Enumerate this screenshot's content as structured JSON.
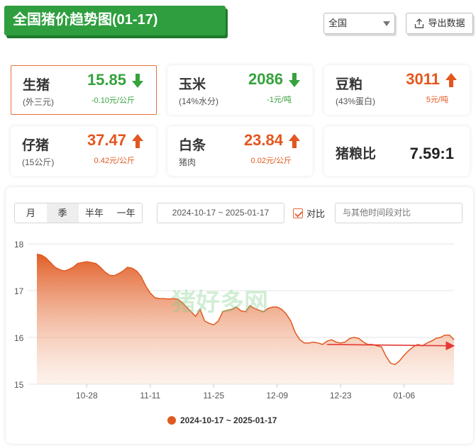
{
  "header": {
    "title": "全国猪价趋势图(01-17)",
    "region": "全国",
    "export_label": "导出数据"
  },
  "cards": {
    "hog": {
      "name": "生猪",
      "sub": "(外三元)",
      "price": "15.85",
      "change": "-0.10元/公斤",
      "direction": "down"
    },
    "corn": {
      "name": "玉米",
      "sub": "(14%水分)",
      "price": "2086",
      "change": "-1元/吨",
      "direction": "down"
    },
    "soymeal": {
      "name": "豆粕",
      "sub": "(43%蛋白)",
      "price": "3011",
      "change": "5元/吨",
      "direction": "up"
    },
    "piglet": {
      "name": "仔猪",
      "sub": "(15公斤)",
      "price": "37.47",
      "change": "0.42元/公斤",
      "direction": "up"
    },
    "carcass": {
      "name": "白条",
      "sub": "猪肉",
      "price": "23.84",
      "change": "0.02元/公斤",
      "direction": "up"
    },
    "ratio": {
      "name": "猪粮比",
      "value": "7.59:1"
    }
  },
  "controls": {
    "periods": [
      "月",
      "季",
      "半年",
      "一年"
    ],
    "selected_period": "季",
    "date_range": "2024-10-17 ~ 2025-01-17",
    "compare_label": "对比",
    "compare_placeholder": "与其他时间段对比"
  },
  "colors": {
    "up": "#e3561d",
    "down": "#36a23c",
    "line": "#e05a20",
    "accent": "#2e9e3e"
  },
  "chart_data": {
    "type": "area",
    "title": "",
    "xlabel": "",
    "ylabel": "",
    "ylim": [
      15,
      18
    ],
    "yticks": [
      15,
      16,
      17,
      18
    ],
    "x_ticks": [
      "10-28",
      "11-11",
      "11-25",
      "12-09",
      "12-23",
      "01-06"
    ],
    "x": [
      "10-17",
      "10-18",
      "10-19",
      "10-20",
      "10-21",
      "10-22",
      "10-23",
      "10-24",
      "10-25",
      "10-26",
      "10-27",
      "10-28",
      "10-29",
      "10-30",
      "10-31",
      "11-01",
      "11-02",
      "11-03",
      "11-04",
      "11-05",
      "11-06",
      "11-07",
      "11-08",
      "11-09",
      "11-10",
      "11-11",
      "11-12",
      "11-13",
      "11-14",
      "11-15",
      "11-16",
      "11-17",
      "11-18",
      "11-19",
      "11-20",
      "11-21",
      "11-22",
      "11-23",
      "11-24",
      "11-25",
      "11-26",
      "11-27",
      "11-28",
      "11-29",
      "11-30",
      "12-01",
      "12-02",
      "12-03",
      "12-04",
      "12-05",
      "12-06",
      "12-07",
      "12-08",
      "12-09",
      "12-10",
      "12-11",
      "12-12",
      "12-13",
      "12-14",
      "12-15",
      "12-16",
      "12-17",
      "12-18",
      "12-19",
      "12-20",
      "12-21",
      "12-22",
      "12-23",
      "12-24",
      "12-25",
      "12-26",
      "12-27",
      "12-28",
      "12-29",
      "12-30",
      "12-31",
      "01-01",
      "01-02",
      "01-03",
      "01-04",
      "01-05",
      "01-06",
      "01-07",
      "01-08",
      "01-09",
      "01-10",
      "01-11",
      "01-12",
      "01-13",
      "01-14",
      "01-15",
      "01-16",
      "01-17"
    ],
    "series": [
      {
        "name": "2024-10-17 ~ 2025-01-17",
        "values": [
          17.78,
          17.76,
          17.7,
          17.6,
          17.5,
          17.45,
          17.42,
          17.45,
          17.5,
          17.58,
          17.6,
          17.62,
          17.6,
          17.58,
          17.5,
          17.4,
          17.33,
          17.32,
          17.36,
          17.42,
          17.5,
          17.48,
          17.42,
          17.3,
          17.1,
          16.95,
          16.85,
          16.83,
          16.83,
          16.82,
          16.83,
          16.82,
          16.75,
          16.65,
          16.55,
          16.45,
          16.6,
          16.35,
          16.3,
          16.27,
          16.35,
          16.55,
          16.58,
          16.6,
          16.65,
          16.57,
          16.55,
          16.68,
          16.62,
          16.58,
          16.55,
          16.62,
          16.65,
          16.65,
          16.6,
          16.5,
          16.35,
          16.1,
          15.95,
          15.88,
          15.88,
          15.9,
          15.88,
          15.85,
          15.92,
          15.95,
          15.9,
          15.88,
          15.9,
          15.98,
          16.0,
          15.98,
          15.9,
          15.85,
          15.85,
          15.82,
          15.8,
          15.6,
          15.45,
          15.42,
          15.5,
          15.62,
          15.72,
          15.8,
          15.85,
          15.82,
          15.88,
          15.92,
          15.98,
          16.0,
          16.05,
          16.05,
          15.95
        ],
        "values_note_removed": null
      }
    ],
    "trend_line": {
      "from": 15.85,
      "to": 15.82
    },
    "legend": [
      "2024-10-17 ~ 2025-01-17"
    ],
    "legend_position": "bottom",
    "grid": true
  }
}
